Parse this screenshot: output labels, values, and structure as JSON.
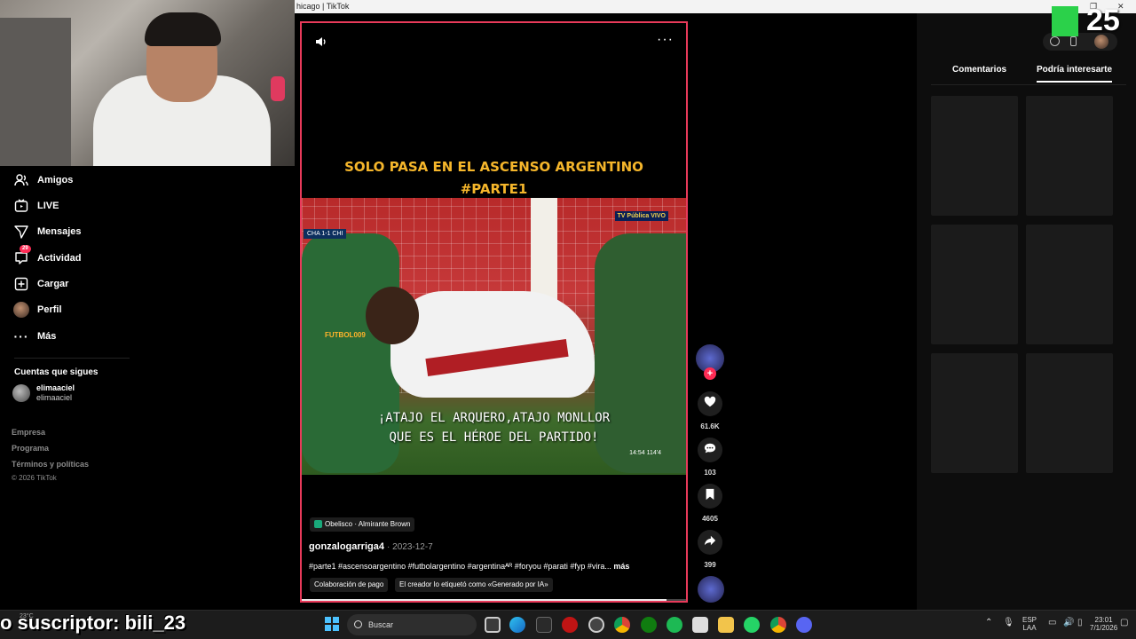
{
  "window": {
    "title": "hicago | TikTok",
    "minimize": "–",
    "maximize": "❐",
    "close": "✕"
  },
  "nav": [
    {
      "label": "Amigos",
      "icon": "friends-icon"
    },
    {
      "label": "LIVE",
      "icon": "live-icon"
    },
    {
      "label": "Mensajes",
      "icon": "messages-icon"
    },
    {
      "label": "Actividad",
      "icon": "activity-icon",
      "badge": "29"
    },
    {
      "label": "Cargar",
      "icon": "upload-icon"
    },
    {
      "label": "Perfil",
      "icon": "profile-avatar"
    },
    {
      "label": "Más",
      "icon": "more-icon"
    }
  ],
  "following": {
    "title": "Cuentas que sigues",
    "accounts": [
      {
        "name": "elimaaciel",
        "handle": "elimaaciel"
      }
    ]
  },
  "footer": {
    "links": [
      "Empresa",
      "Programa",
      "Términos y políticas"
    ],
    "copyright": "© 2026 TikTok"
  },
  "video": {
    "caption_line1": "SOLO PASA EN EL ASCENSO ARGENTINO",
    "caption_line2": "#PARTE1",
    "subtitle_line1": "¡ATAJO EL ARQUERO,ATAJO MONLLOR",
    "subtitle_line2": "QUE ES EL HÉROE DEL PARTIDO!",
    "scoreboard": "CHA 1-1 CHI",
    "channel_logo": "TV Pública VIVO",
    "watermark": "FUTBOL009",
    "clip_time": "14:54 114'4",
    "progress": 0.95,
    "location_tag": "Obelisco · Almirante Brown",
    "author": "gonzalogarriga4",
    "date": "· 2023-12-7",
    "description": "#parte1 #ascensoargentino #futbolargentino #argentinaᴬᴿ #foryou #parati #fyp #vira...",
    "more_label": "más",
    "chips": [
      "Colaboración de pago",
      "El creador lo etiquetó como «Generado por IA»"
    ]
  },
  "actions": {
    "likes": "61.6K",
    "comments": "103",
    "saves": "4605",
    "shares": "399"
  },
  "right_panel": {
    "tabs": [
      "Comentarios",
      "Podría interesarte"
    ],
    "active_tab": "Podría interesarte"
  },
  "overlay": {
    "subscriber_text": "o suscriptor: bili_23",
    "temp": "23°C",
    "logo_number": "25"
  },
  "taskbar": {
    "search_placeholder": "Buscar",
    "lang": "ESP",
    "lang2": "LAA",
    "time": "23:01",
    "date": "7/1/2026"
  }
}
